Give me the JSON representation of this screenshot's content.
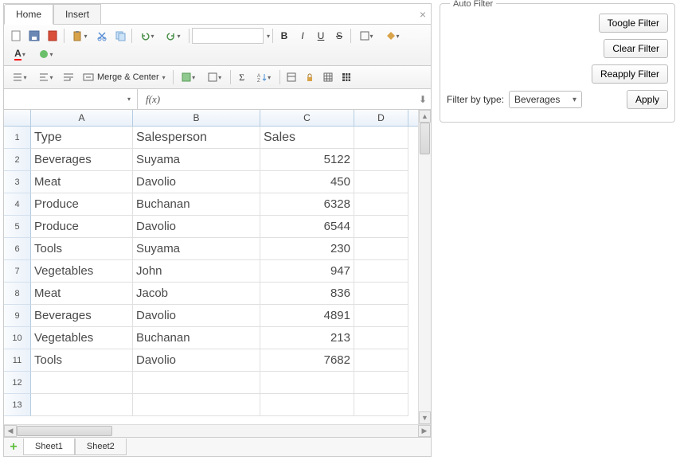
{
  "tabs": {
    "home": "Home",
    "insert": "Insert"
  },
  "toolbar": {
    "merge": "Merge & Center"
  },
  "formula": {
    "fx": "f(x)"
  },
  "columns": [
    "A",
    "B",
    "C",
    "D"
  ],
  "headers": {
    "type": "Type",
    "sales_person": "Salesperson",
    "sales": "Sales"
  },
  "rows": [
    {
      "type": "Beverages",
      "sp": "Suyama",
      "sales": "5122"
    },
    {
      "type": "Meat",
      "sp": "Davolio",
      "sales": "450"
    },
    {
      "type": "Produce",
      "sp": "Buchanan",
      "sales": "6328"
    },
    {
      "type": "Produce",
      "sp": "Davolio",
      "sales": "6544"
    },
    {
      "type": "Tools",
      "sp": "Suyama",
      "sales": "230"
    },
    {
      "type": "Vegetables",
      "sp": "John",
      "sales": "947"
    },
    {
      "type": "Meat",
      "sp": "Jacob",
      "sales": "836"
    },
    {
      "type": "Beverages",
      "sp": "Davolio",
      "sales": "4891"
    },
    {
      "type": "Vegetables",
      "sp": "Buchanan",
      "sales": "213"
    },
    {
      "type": "Tools",
      "sp": "Davolio",
      "sales": "7682"
    }
  ],
  "sheets": {
    "s1": "Sheet1",
    "s2": "Sheet2"
  },
  "panel": {
    "title": "Auto Filter",
    "toggle": "Toogle Filter",
    "clear": "Clear Filter",
    "reapply": "Reapply Filter",
    "filter_label": "Filter by type:",
    "selected": "Beverages",
    "apply": "Apply"
  }
}
